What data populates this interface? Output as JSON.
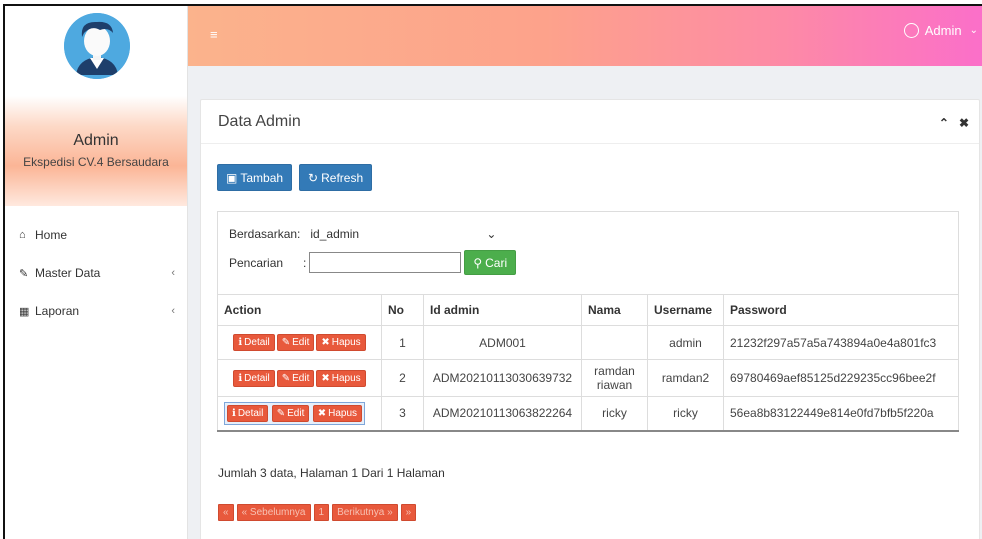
{
  "sidebar": {
    "profile_name": "Admin",
    "profile_subtitle": "Ekspedisi CV.4 Bersaudara",
    "items": [
      {
        "icon": "home-icon",
        "label": "Home",
        "has_chevron": false
      },
      {
        "icon": "edit-icon",
        "label": "Master Data",
        "has_chevron": true
      },
      {
        "icon": "calendar-icon",
        "label": "Laporan",
        "has_chevron": true
      }
    ]
  },
  "topbar": {
    "menu_icon": "hamburger-icon",
    "user_label": "Admin"
  },
  "panel": {
    "title": "Data Admin",
    "add_label": "Tambah",
    "refresh_label": "Refresh",
    "search": {
      "filter_label": "Berdasarkan:",
      "filter_value": "id_admin",
      "query_label": "Pencarian",
      "query_value": "",
      "search_button": "Cari"
    },
    "table": {
      "headers": [
        "Action",
        "No",
        "Id admin",
        "Nama",
        "Username",
        "Password"
      ],
      "action_labels": {
        "detail": "Detail",
        "edit": "Edit",
        "delete": "Hapus"
      },
      "rows": [
        {
          "no": "1",
          "id_admin": "ADM001",
          "nama": "",
          "username": "admin",
          "password": "21232f297a57a5a743894a0e4a801fc3"
        },
        {
          "no": "2",
          "id_admin": "ADM20210113030639732",
          "nama": "ramdan riawan",
          "username": "ramdan2",
          "password": "69780469aef85125d229235cc96bee2f"
        },
        {
          "no": "3",
          "id_admin": "ADM20210113063822264",
          "nama": "ricky",
          "username": "ricky",
          "password": "56ea8b83122449e814e0fd7bfb5f220a"
        }
      ]
    },
    "summary": "Jumlah 3 data, Halaman 1 Dari 1 Halaman",
    "pager": {
      "first": "«",
      "prev": "« Sebelumnya",
      "page": "1",
      "next": "Berikutnya »",
      "last": "»"
    }
  },
  "colors": {
    "accent_primary": "#337ab7",
    "accent_success": "#4cae4c",
    "danger": "#e8593c"
  }
}
